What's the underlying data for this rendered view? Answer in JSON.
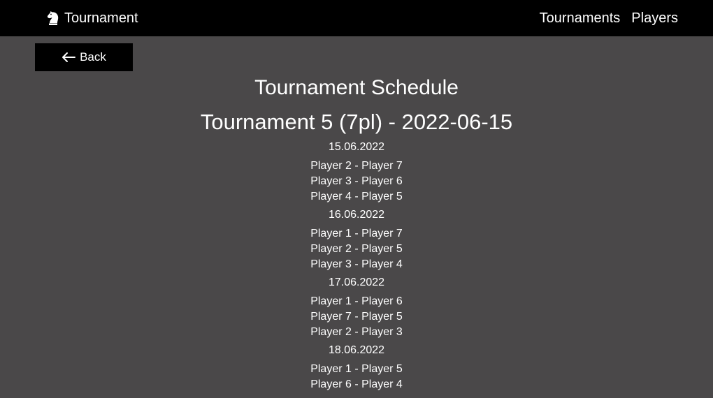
{
  "header": {
    "brand": "Tournament",
    "brand_icon": "chess-knight-icon",
    "nav": [
      {
        "label": "Tournaments"
      },
      {
        "label": "Players"
      }
    ]
  },
  "back_button": {
    "label": "Back",
    "icon": "arrow-left-icon"
  },
  "schedule": {
    "title": "Tournament Schedule",
    "tournament": "Tournament 5 (7pl) - 2022-06-15",
    "days": [
      {
        "date": "15.06.2022",
        "matches": [
          "Player 2 - Player 7",
          "Player 3 - Player 6",
          "Player 4 - Player 5"
        ]
      },
      {
        "date": "16.06.2022",
        "matches": [
          "Player 1 - Player 7",
          "Player 2 - Player 5",
          "Player 3 - Player 4"
        ]
      },
      {
        "date": "17.06.2022",
        "matches": [
          "Player 1 - Player 6",
          "Player 7 - Player 5",
          "Player 2 - Player 3"
        ]
      },
      {
        "date": "18.06.2022",
        "matches": [
          "Player 1 - Player 5",
          "Player 6 - Player 4"
        ]
      }
    ]
  },
  "colors": {
    "background": "#4a4849",
    "header": "#000000",
    "text": "#ffffff"
  }
}
